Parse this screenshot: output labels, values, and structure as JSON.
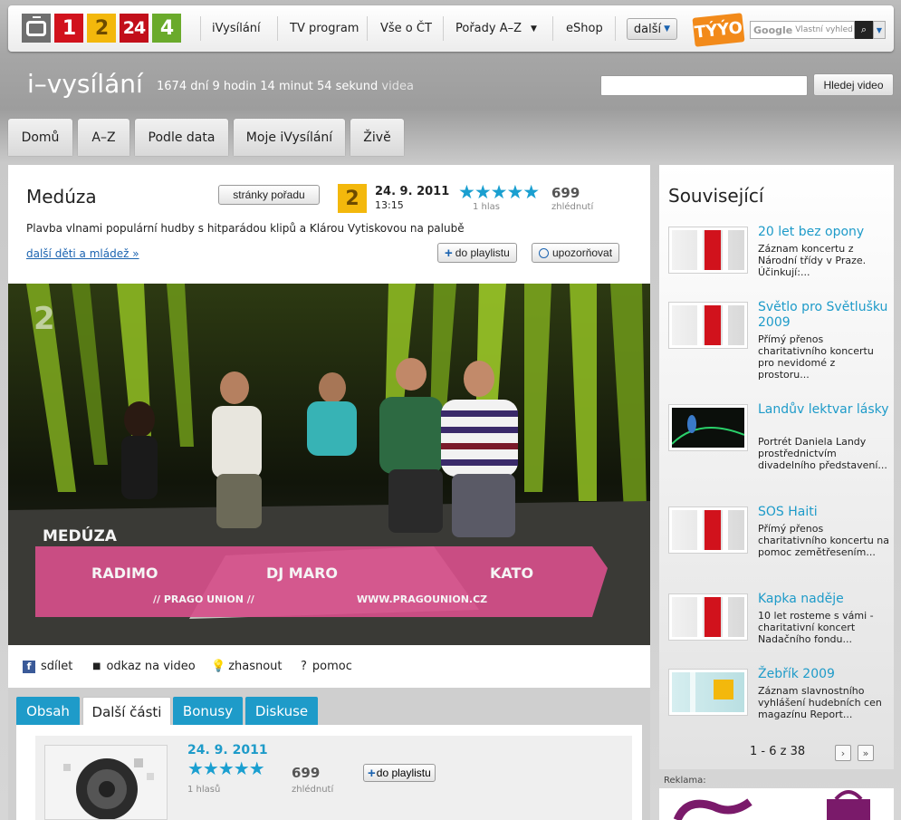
{
  "topnav": {
    "logos": [
      "1",
      "2",
      "24",
      "4"
    ],
    "links": [
      "iVysílání",
      "TV program",
      "Vše o ČT",
      "Pořady A–Z",
      "eShop"
    ],
    "more": "další",
    "tyyo": "TÝÝO",
    "google_brand": "Google",
    "google_placeholder": "Vlastní vyhled"
  },
  "header": {
    "brand": "i–vysílání",
    "countdown": "1674 dní 9 hodin 14 minut 54 sekund",
    "countdown_suffix": "videa",
    "search_button": "Hledej video"
  },
  "tabs": [
    "Domů",
    "A–Z",
    "Podle data",
    "Moje iVysílání",
    "Živě"
  ],
  "episode": {
    "title": "Medúza",
    "show_page_button": "stránky pořadu",
    "channel": "2",
    "date": "24. 9. 2011",
    "time": "13:15",
    "stars": "★★★★★",
    "votes": "1 hlas",
    "views": "699",
    "views_label": "zhlédnutí",
    "description": "Plavba vlnami populární hudby s hitparádou klipů a Klárou Vytiskovou na palubě",
    "more_link": "další děti a mládež »",
    "playlist_button": "do playlistu",
    "notify_button": "upozorňovat"
  },
  "video": {
    "show_caption": "MEDÚZA",
    "names": [
      "RADIMO",
      "DJ MARO",
      "KATO"
    ],
    "group": "// PRAGO UNION //",
    "url": "WWW.PRAGOUNION.CZ",
    "channel_mark": "2"
  },
  "actions": [
    "sdílet",
    "odkaz na video",
    "zhasnout",
    "pomoc"
  ],
  "lower_tabs": [
    "Obsah",
    "Další části",
    "Bonusy",
    "Diskuse"
  ],
  "lower_item": {
    "date": "24. 9. 2011",
    "stars": "★★★★★",
    "votes": "1 hlasů",
    "views": "699",
    "views_label": "zhlédnutí",
    "playlist_button": "do playlistu"
  },
  "sidebar": {
    "title": "Související",
    "items": [
      {
        "title": "20 let bez opony",
        "desc": "Záznam koncertu z Národní třídy v Praze. Účinkují:..."
      },
      {
        "title": "Světlo pro Světlušku 2009",
        "desc": "Přímý přenos charitativního koncertu pro nevidomé z prostoru..."
      },
      {
        "title": "Landův lektvar lásky",
        "desc": "Portrét Daniela Landy prostřednictvím divadelního představení..."
      },
      {
        "title": "SOS Haiti",
        "desc": "Přímý přenos charitativního koncertu na pomoc zemětřesením..."
      },
      {
        "title": "Kapka naděje",
        "desc": "10 let rosteme s vámi - charitativní koncert Nadačního fondu..."
      },
      {
        "title": "Žebřík 2009",
        "desc": "Záznam slavnostního vyhlášení hudebních cen magazínu Report..."
      }
    ],
    "pager": "1 - 6 z 38",
    "next": "›",
    "last": "»"
  },
  "ad_label": "Reklama:",
  "colors": {
    "accent": "#1e9bc9",
    "link": "#1b63b0",
    "ct1": "#d1121c",
    "ct2": "#f3b80c",
    "ct4": "#6aaa2b"
  }
}
